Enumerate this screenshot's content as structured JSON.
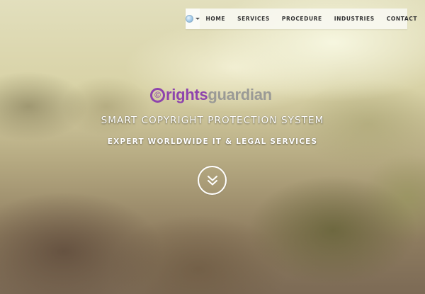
{
  "nav": {
    "language_icon": "globe-icon",
    "items": [
      "HOME",
      "SERVICES",
      "PROCEDURE",
      "INDUSTRIES",
      "CONTACT"
    ]
  },
  "logo": {
    "mark": "©",
    "text_part1": "rights",
    "text_part2": "guardian",
    "colors": {
      "primary": "#8e44ad",
      "secondary": "#9a9a96"
    }
  },
  "hero": {
    "headline": "SMART COPYRIGHT PROTECTION SYSTEM",
    "subheadline": "EXPERT WORLDWIDE IT & LEGAL SERVICES",
    "scroll_icon": "double-chevron-down-icon"
  }
}
